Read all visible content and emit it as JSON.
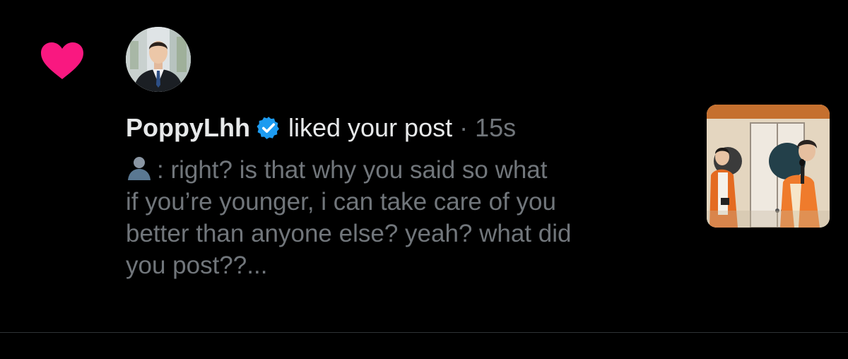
{
  "notification": {
    "type_icon": "heart-icon",
    "accent_color": "#f91880",
    "avatar_icon": "profile-photo",
    "username": "PoppyLhh",
    "verified_icon": "verified-badge-icon",
    "verified_color": "#1d9bf0",
    "action": "liked your post",
    "separator": "·",
    "time": "15s",
    "body_icon": "bust-silhouette-icon",
    "body_text": ": right? is that why you said so what\nif you’re younger, i can take care of you\nbetter than anyone else? yeah? what did\nyou post??...",
    "thumbnail_icon": "post-thumbnail-photo"
  }
}
